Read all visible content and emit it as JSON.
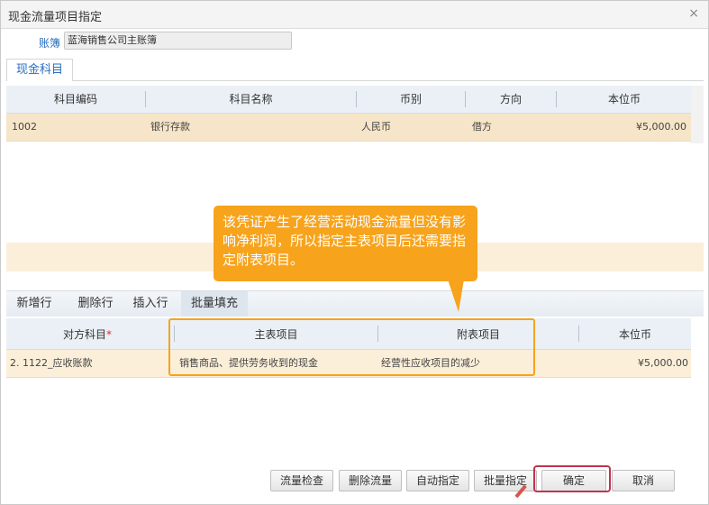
{
  "dialog": {
    "title": "现金流量项目指定",
    "close_glyph": "×"
  },
  "account": {
    "label": "账簿",
    "value": "蓝海销售公司主账簿"
  },
  "tab": {
    "label": "现金科目"
  },
  "cash_table": {
    "columns": [
      "科目编码",
      "科目名称",
      "币别",
      "方向",
      "本位币"
    ],
    "rows": [
      {
        "code": "1002",
        "name": "银行存款",
        "currency": "人民币",
        "direction": "借方",
        "amount": "¥5,000.00"
      }
    ]
  },
  "toolbar": {
    "add_row": "新增行",
    "delete_row": "删除行",
    "insert_row": "插入行",
    "batch_fill": "批量填充"
  },
  "flow_table": {
    "columns": {
      "counter_account": "对方科目",
      "required_mark": "*",
      "main_item": "主表项目",
      "sub_item": "附表项目",
      "amount": "本位币"
    },
    "rows": [
      {
        "counter_account": "2. 1122_应收账款",
        "main_item": "销售商品、提供劳务收到的现金",
        "sub_item": "经营性应收项目的减少",
        "amount": "¥5,000.00"
      }
    ]
  },
  "callout": {
    "text": "该凭证产生了经营活动现金流量但没有影响净利润，所以指定主表项目后还需要指定附表项目。"
  },
  "footer": {
    "flow_check": "流量检查",
    "delete_flow": "删除流量",
    "auto_assign": "自动指定",
    "batch_assign": "批量指定",
    "confirm": "确定",
    "cancel": "取消"
  },
  "colors": {
    "accent": "#2a6ebb",
    "row_highlight": "#f6e5c8",
    "callout": "#f7a31c",
    "confirm_outline": "#c0344d"
  }
}
